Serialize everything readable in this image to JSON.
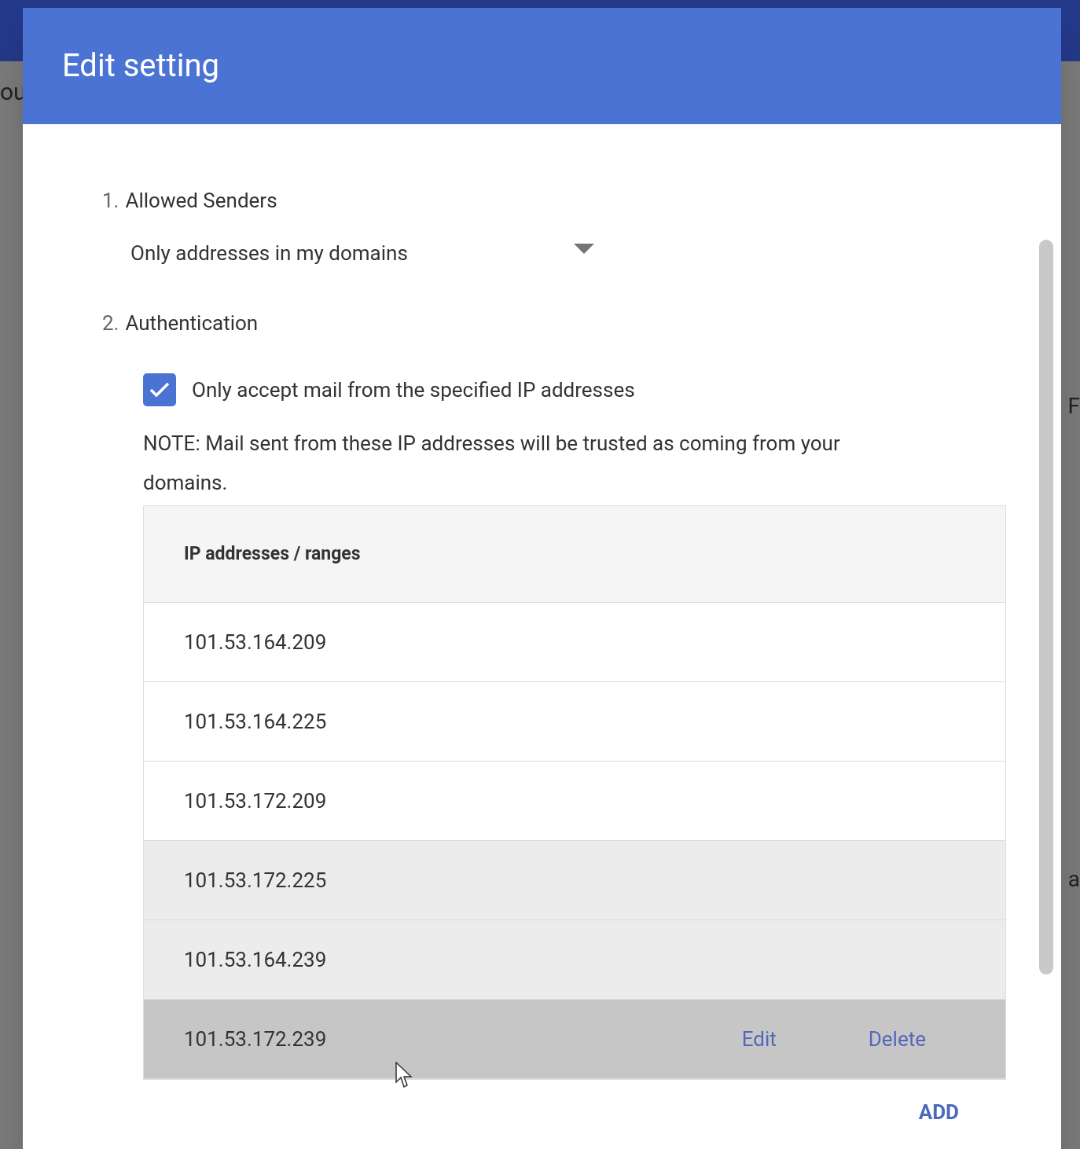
{
  "background": {
    "left_text": "ou",
    "right_texts": [
      "F",
      "a"
    ]
  },
  "dialog": {
    "title": "Edit setting",
    "sections": [
      {
        "number": "1.",
        "label": "Allowed Senders",
        "kind": "dropdown",
        "value": "Only addresses in my domains"
      },
      {
        "number": "2.",
        "label": "Authentication",
        "kind": "checkbox",
        "checkbox": {
          "label": "Only accept mail from the specified IP addresses",
          "checked": true
        },
        "note": "NOTE: Mail sent from these IP addresses will be trusted as coming from your domains.",
        "table": {
          "columns": [
            "IP addresses / ranges"
          ],
          "rows": [
            {
              "address": "101.53.164.209",
              "hovered": false
            },
            {
              "address": "101.53.164.225",
              "hovered": false
            },
            {
              "address": "101.53.172.209",
              "hovered": false
            },
            {
              "address": "101.53.172.225",
              "hovered": false
            },
            {
              "address": "101.53.164.239",
              "hovered": false
            },
            {
              "address": "101.53.172.239",
              "hovered": true,
              "actions": [
                "Edit",
                "Delete"
              ]
            }
          ]
        },
        "add_button": "ADD"
      }
    ]
  }
}
